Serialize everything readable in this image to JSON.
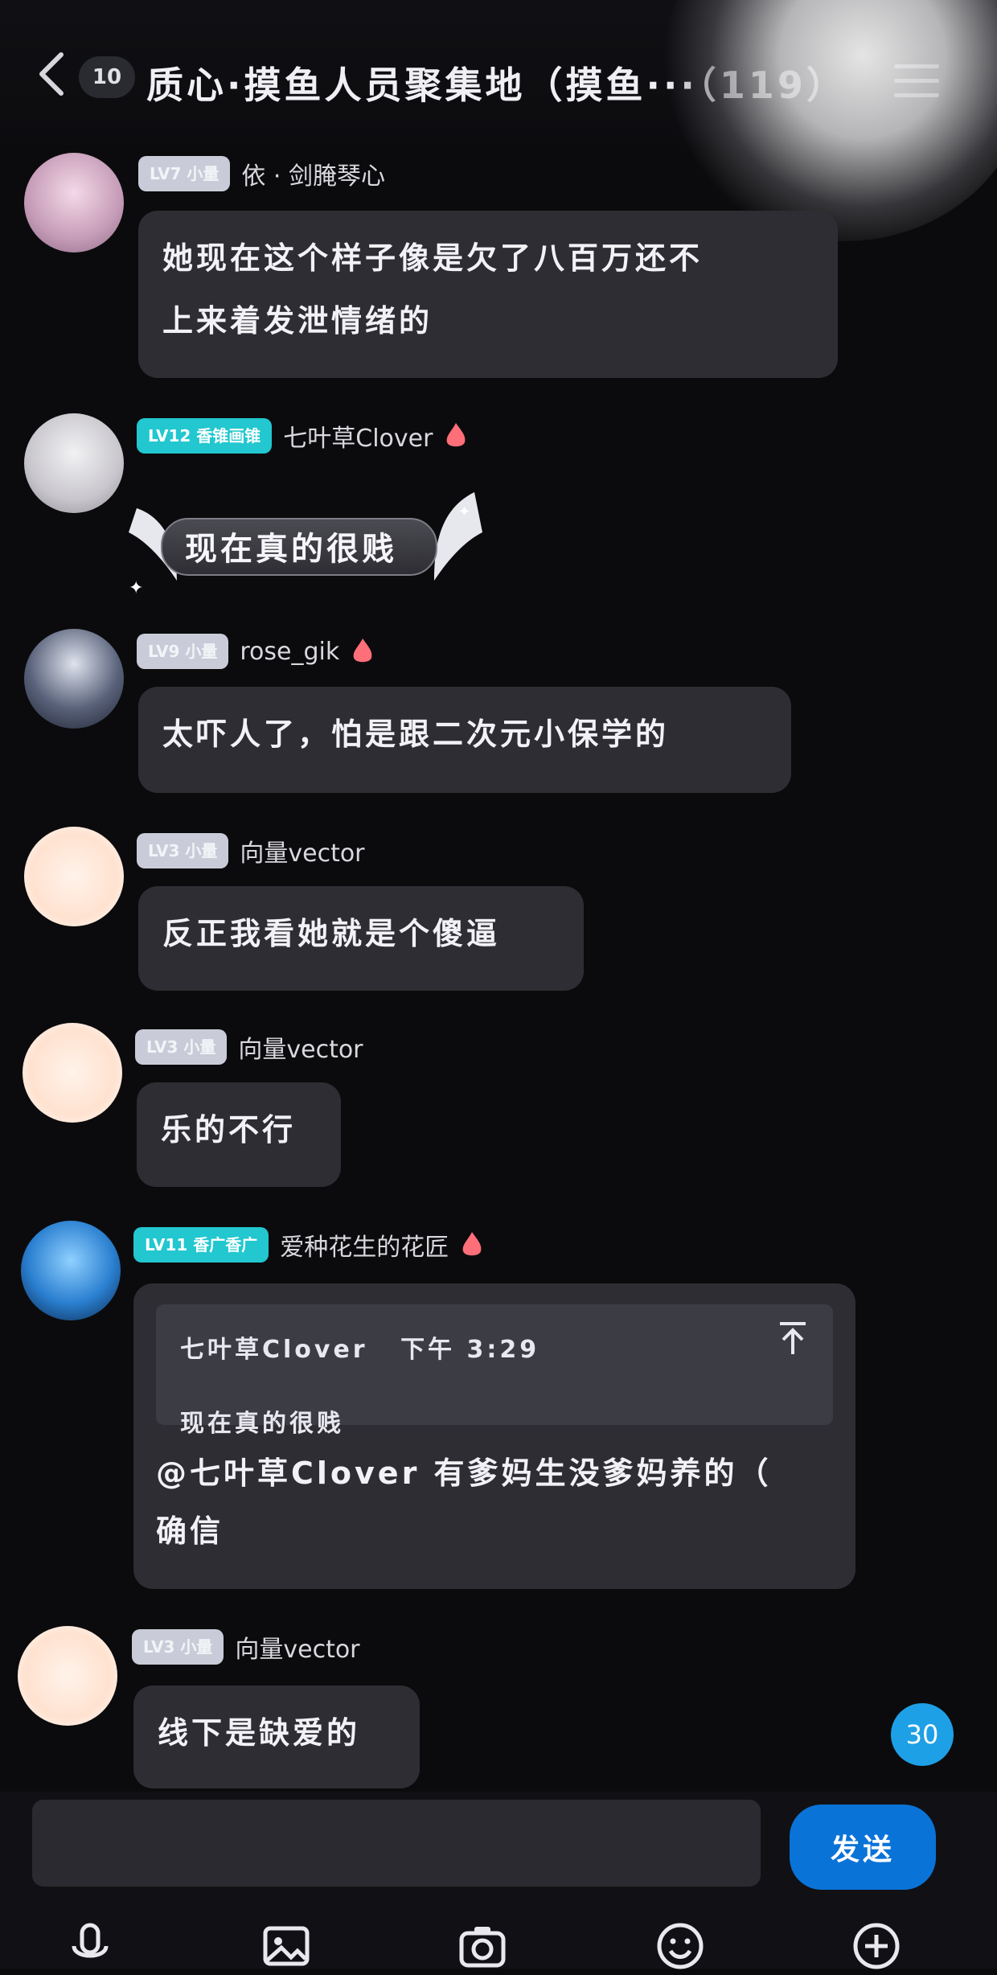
{
  "header": {
    "unread_count": "10",
    "title": "质心·摸鱼人员聚集地（摸鱼···（119）"
  },
  "messages": [
    {
      "level": "LV7 小量",
      "nick": "依 · 剑腌琴心",
      "text_lines": [
        "她现在这个样子像是欠了八百万还不",
        "上来着发泄情绪的"
      ]
    },
    {
      "level": "LV12 香锥画锥",
      "nick": "七叶草Clover",
      "text": "现在真的很贱"
    },
    {
      "level": "LV9 小量",
      "nick": "rose_gik",
      "text": "太吓人了，怕是跟二次元小保学的"
    },
    {
      "level": "LV3 小量",
      "nick": "向量vector",
      "text": "反正我看她就是个傻逼"
    },
    {
      "level": "LV3 小量",
      "nick": "向量vector",
      "text": "乐的不行"
    },
    {
      "level": "LV11 香广香广",
      "nick": "爱种花生的花匠",
      "quote": {
        "author": "七叶草Clover",
        "time": "下午 3:29",
        "text": "现在真的很贱"
      },
      "text_lines": [
        "@七叶草Clover 有爹妈生没爹妈养的（",
        "确信"
      ]
    },
    {
      "level": "LV3 小量",
      "nick": "向量vector",
      "text": "线下是缺爱的"
    }
  ],
  "unread_float": "30",
  "input": {
    "value": "",
    "send_label": "发送"
  },
  "toolbar": [
    "mic-icon",
    "image-icon",
    "camera-icon",
    "emoji-icon",
    "plus-icon"
  ],
  "colors": {
    "send": "#0a73d8",
    "bubble": "#2d2d33",
    "teal_level": "#22c7cf",
    "unread_float": "#1ea0e6"
  }
}
